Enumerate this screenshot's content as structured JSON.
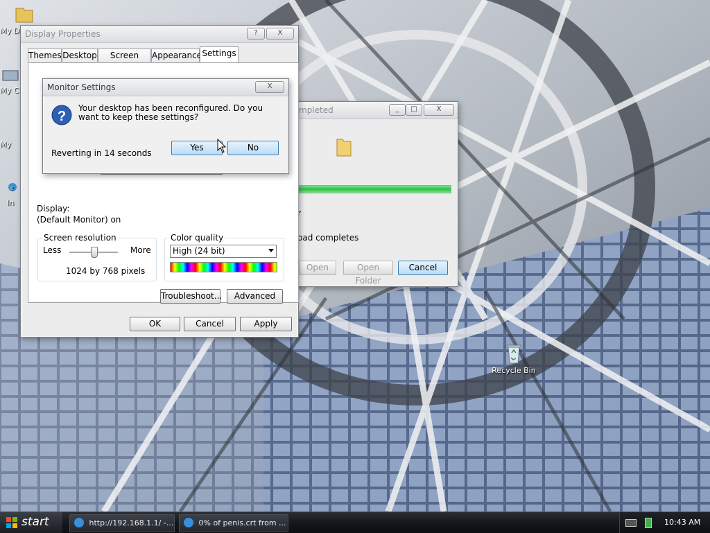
{
  "desktop": {
    "icons": [
      {
        "label": "My D"
      },
      {
        "label": "My C"
      },
      {
        "label": "My"
      },
      {
        "label": "In"
      },
      {
        "label": "Recycle Bin"
      }
    ]
  },
  "display_properties": {
    "title": "Display Properties",
    "help_btn": "?",
    "close_btn": "X",
    "tabs": [
      "Themes",
      "Desktop",
      "Screen Saver",
      "Appearance",
      "Settings"
    ],
    "display_label": "Display:",
    "display_value": "(Default Monitor) on",
    "screen_resolution": {
      "legend": "Screen resolution",
      "less": "Less",
      "more": "More",
      "value": "1024 by 768 pixels",
      "slider_fraction": 0.5
    },
    "color_quality": {
      "legend": "Color quality",
      "selected": "High (24 bit)"
    },
    "troubleshoot_btn": "Troubleshoot...",
    "advanced_btn": "Advanced",
    "ok_btn": "OK",
    "cancel_btn": "Cancel",
    "apply_btn": "Apply"
  },
  "monitor_settings": {
    "title": "Monitor Settings",
    "close_btn": "X",
    "message": "Your desktop has been reconfigured.  Do you want to keep these settings?",
    "countdown": "Reverting in 14 seconds",
    "yes_btn": "Yes",
    "no_btn": "No"
  },
  "download_dialog": {
    "title": "mpleted",
    "line1": "r",
    "line2": "oad completes",
    "progress": 1.0,
    "open_btn": "Open",
    "open_folder_btn": "Open Folder",
    "cancel_btn": "Cancel"
  },
  "taskbar": {
    "start": "start",
    "items": [
      "http://192.168.1.1/ -...",
      "0% of penis.crt from ..."
    ],
    "clock": "10:43 AM"
  },
  "colors": {
    "accent": "#3c7fb1",
    "progress": "#2fc04a"
  }
}
